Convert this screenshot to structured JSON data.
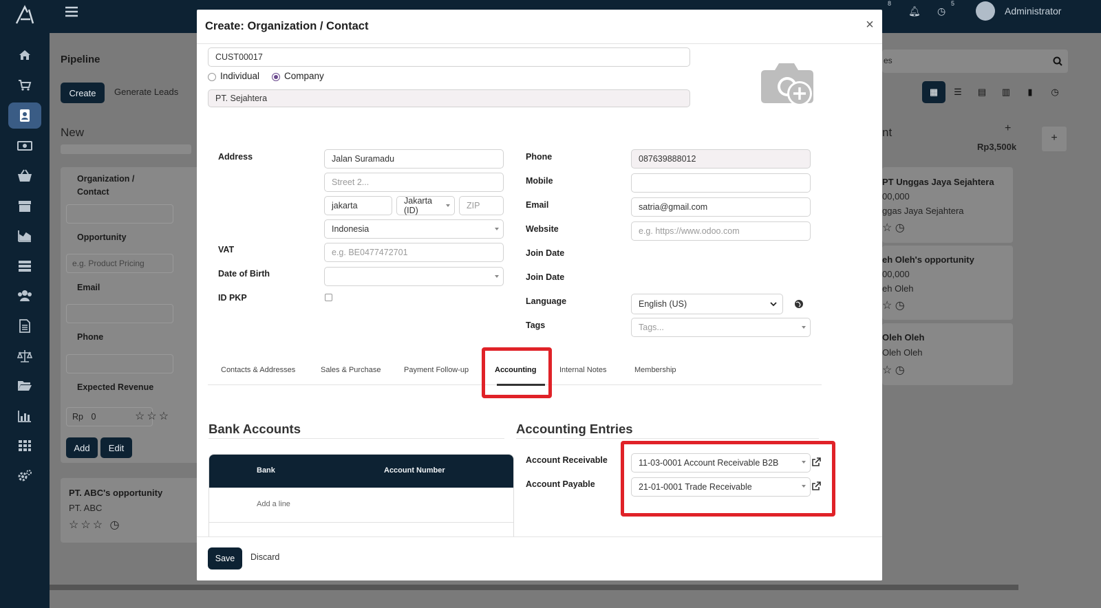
{
  "app": {
    "user_name": "Administrator",
    "notif_count_chat": "8",
    "notif_count_activity": "5"
  },
  "background": {
    "page_title": "Pipeline",
    "create_label": "Create",
    "generate_leads_label": "Generate Leads",
    "column_new": "New",
    "quick_create": {
      "org_label": "Organization / Contact",
      "opportunity_label": "Opportunity",
      "opportunity_placeholder": "e.g. Product Pricing",
      "email_label": "Email",
      "phone_label": "Phone",
      "revenue_label": "Expected Revenue",
      "currency": "Rp",
      "revenue_value": "0",
      "add_label": "Add",
      "edit_label": "Edit"
    },
    "left_card": {
      "title": "PT. ABC's opportunity",
      "company": "PT. ABC"
    },
    "right_column": {
      "title_partial": "nt",
      "amount": "Rp3,500k",
      "cards": [
        {
          "title": "PT Unggas Jaya Sejahtera",
          "amount": "00,000",
          "company": "ggas Jaya Sejahtera"
        },
        {
          "title": "eh Oleh's opportunity",
          "amount": "00,000",
          "company": "eh Oleh"
        },
        {
          "title": "Oleh Oleh",
          "company": "Oleh Oleh"
        }
      ],
      "search_partial": "es"
    }
  },
  "modal": {
    "title": "Create: Organization / Contact",
    "customer_code": "CUST00017",
    "type_options": {
      "individual": "Individual",
      "company": "Company"
    },
    "company_name": "PT. Sejahtera",
    "address": {
      "label": "Address",
      "street": "Jalan Suramadu",
      "street2_placeholder": "Street 2...",
      "city": "jakarta",
      "state": "Jakarta (ID)",
      "zip_placeholder": "ZIP",
      "country": "Indonesia"
    },
    "vat": {
      "label": "VAT",
      "placeholder": "e.g. BE0477472701"
    },
    "dob_label": "Date of Birth",
    "id_pkp_label": "ID PKP",
    "phone": {
      "label": "Phone",
      "value": "087639888012"
    },
    "mobile_label": "Mobile",
    "email": {
      "label": "Email",
      "value": "satria@gmail.com"
    },
    "website": {
      "label": "Website",
      "placeholder": "e.g. https://www.odoo.com"
    },
    "join_date_label_1": "Join Date",
    "join_date_label_2": "Join Date",
    "language": {
      "label": "Language",
      "value": "English (US)"
    },
    "tags": {
      "label": "Tags",
      "placeholder": "Tags..."
    },
    "tabs": [
      "Contacts & Addresses",
      "Sales & Purchase",
      "Payment Follow-up",
      "Accounting",
      "Internal Notes",
      "Membership"
    ],
    "bank_accounts": {
      "title": "Bank Accounts",
      "col_bank": "Bank",
      "col_account_number": "Account Number",
      "add_line": "Add a line"
    },
    "accounting_entries": {
      "title": "Accounting Entries",
      "receivable_label": "Account Receivable",
      "receivable_value": "11-03-0001 Account Receivable B2B",
      "payable_label": "Account Payable",
      "payable_value": "21-01-0001 Trade Receivable"
    },
    "footer": {
      "save": "Save",
      "discard": "Discard"
    }
  },
  "colors": {
    "brand_dark": "#0d2233",
    "highlight_red": "#e02228",
    "radio_purple": "#6b4a8e"
  }
}
